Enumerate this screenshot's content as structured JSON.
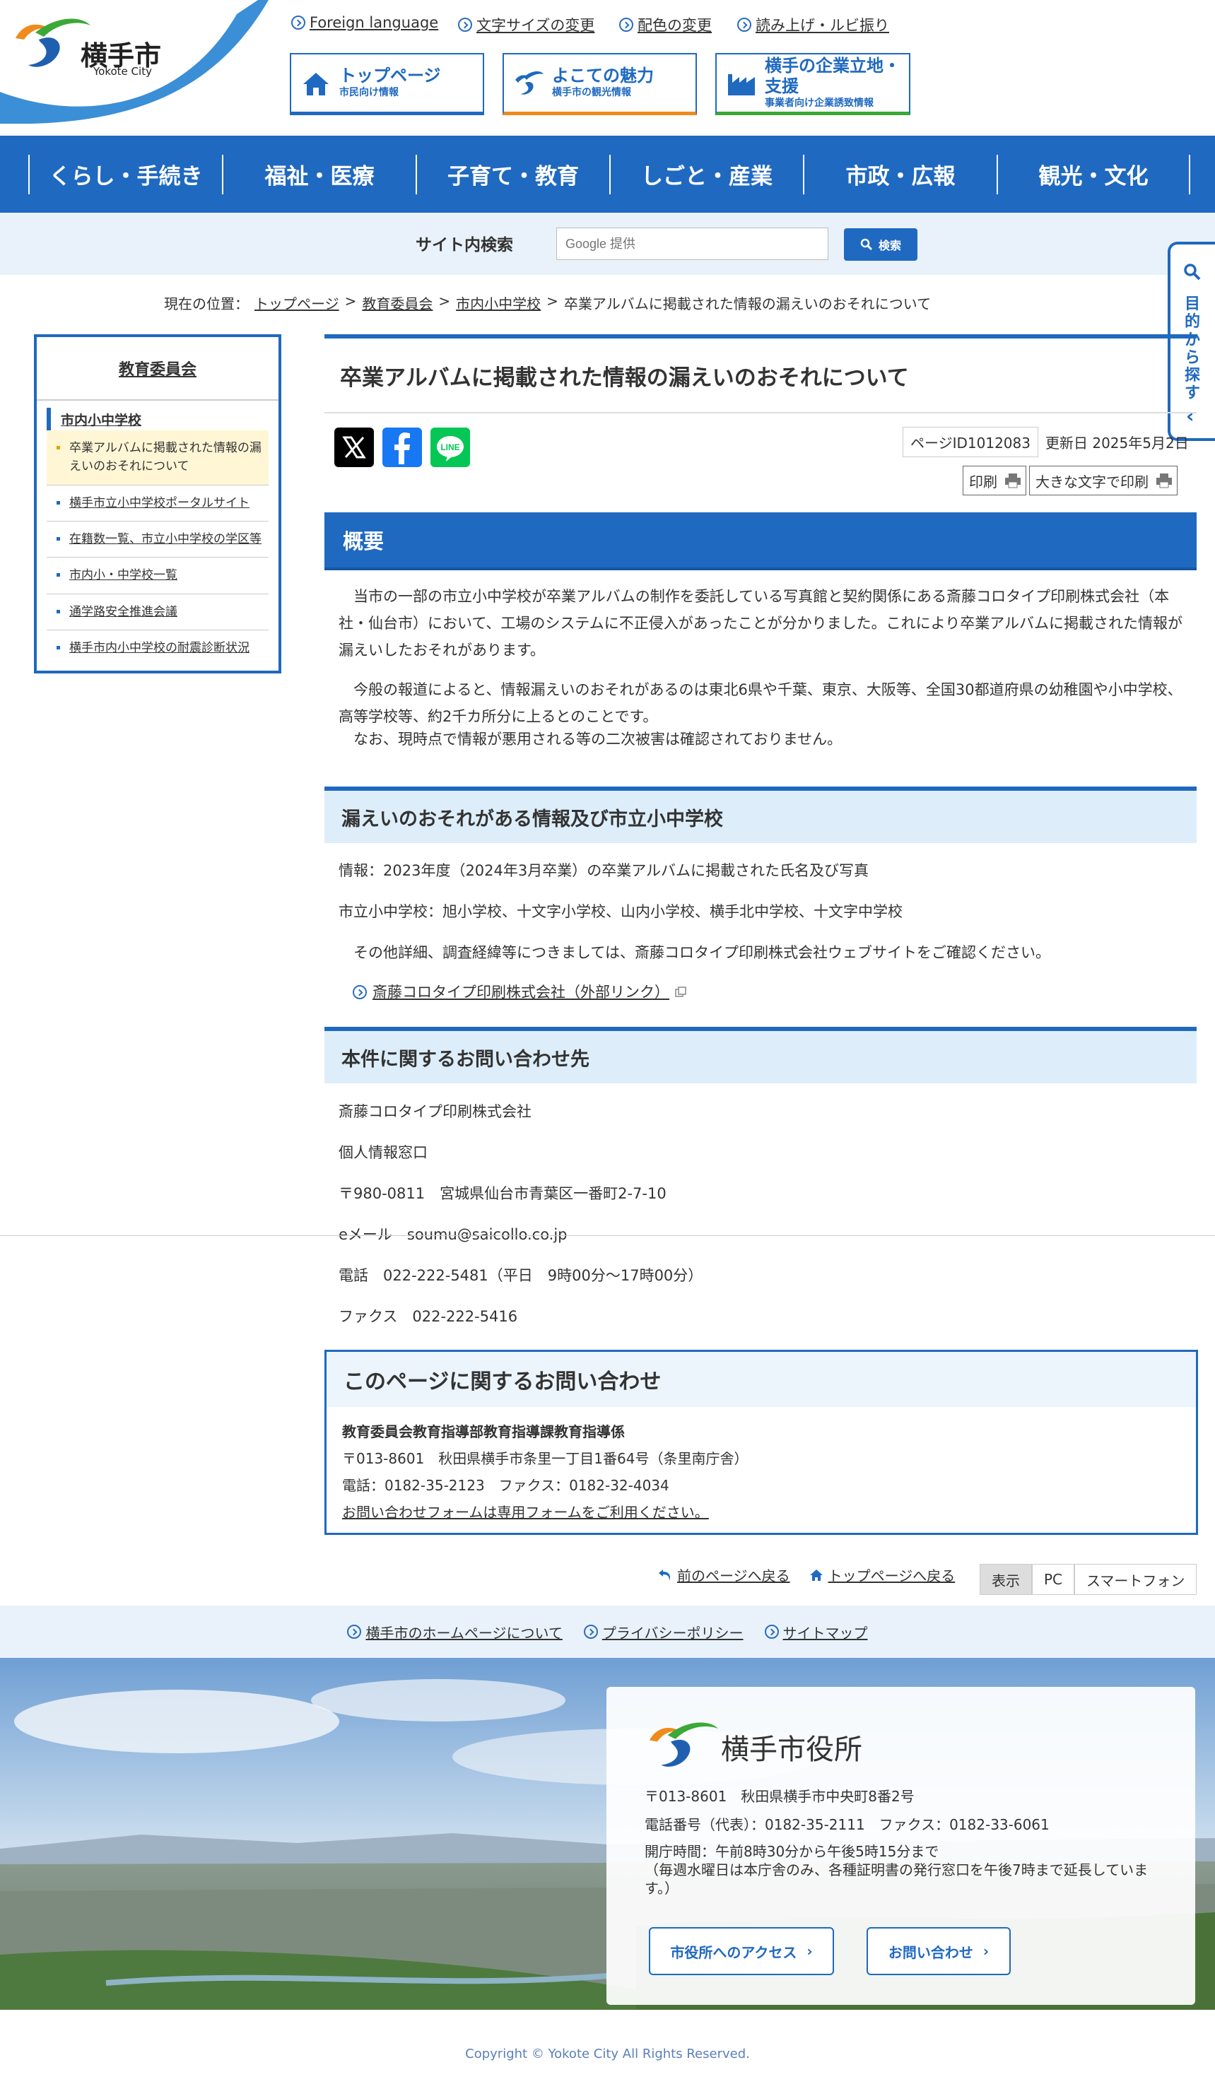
{
  "header": {
    "logo_text": "横手市",
    "logo_sub": "Yokote City",
    "util_links": [
      "Foreign language",
      "文字サイズの変更",
      "配色の変更",
      "読み上げ・ルビ振り"
    ],
    "buttons": [
      {
        "title": "トップページ",
        "sub": "市民向け情報"
      },
      {
        "title": "よこての魅力",
        "sub": "横手市の観光情報"
      },
      {
        "title": "横手の企業立地・支援",
        "sub": "事業者向け企業誘致情報"
      }
    ]
  },
  "gnav": [
    "くらし・手続き",
    "福祉・医療",
    "子育て・教育",
    "しごと・産業",
    "市政・広報",
    "観光・文化"
  ],
  "search": {
    "label": "サイト内検索",
    "placeholder": "Google 提供",
    "button": "検索"
  },
  "side_tab": {
    "label": "目的から探す",
    "chevron": "‹"
  },
  "breadcrumb": {
    "prefix": "現在の位置：",
    "items": [
      "トップページ",
      "教育委員会",
      "市内小中学校"
    ],
    "current": "卒業アルバムに掲載された情報の漏えいのおそれについて",
    "sep": ">"
  },
  "sidebar": {
    "title": "教育委員会",
    "category": "市内小中学校",
    "items": [
      "卒業アルバムに掲載された情報の漏えいのおそれについて",
      "横手市立小中学校ポータルサイト",
      "在籍数一覧、市立小中学校の学区等",
      "市内小・中学校一覧",
      "通学路安全推進会議",
      "横手市内小中学校の耐震診断状況"
    ]
  },
  "page": {
    "title": "卒業アルバムに掲載された情報の漏えいのおそれについて",
    "page_id": "ページID1012083",
    "updated": "更新日 2025年5月2日",
    "print": "印刷",
    "print_large": "大きな文字で印刷",
    "sns": [
      "X",
      "Facebook",
      "LINE"
    ]
  },
  "overview": {
    "heading": "概要",
    "p1": "当市の一部の市立小中学校が卒業アルバムの制作を委託している写真館と契約関係にある斎藤コロタイプ印刷株式会社（本社・仙台市）において、工場のシステムに不正侵入があったことが分かりました。これにより卒業アルバムに掲載された情報が漏えいしたおそれがあります。",
    "p2": "今般の報道によると、情報漏えいのおそれがあるのは東北6県や千葉、東京、大阪等、全国30都道府県の幼稚園や小中学校、高等学校等、約2千カ所分に上るとのことです。",
    "p3": "なお、現時点で情報が悪用される等の二次被害は確認されておりません。"
  },
  "leak": {
    "heading": "漏えいのおそれがある情報及び市立小中学校",
    "info": "情報：2023年度（2024年3月卒業）の卒業アルバムに掲載された氏名及び写真",
    "schools": "市立小中学校：旭小学校、十文字小学校、山内小学校、横手北中学校、十文字中学校",
    "note": "その他詳細、調査経緯等につきましては、斎藤コロタイプ印刷株式会社ウェブサイトをご確認ください。",
    "link": "斎藤コロタイプ印刷株式会社（外部リンク）"
  },
  "inquiry": {
    "heading": "本件に関するお問い合わせ先",
    "lines": [
      "斎藤コロタイプ印刷株式会社",
      "個人情報窓口",
      "〒980-0811　宮城県仙台市青葉区一番町2-7-10",
      "eメール　soumu@saicollo.co.jp",
      "電話　022-222-5481（平日　9時00分～17時00分）",
      "ファクス　022-222-5416"
    ]
  },
  "contact_box": {
    "heading": "このページに関するお問い合わせ",
    "dept": "教育委員会教育指導部教育指導課教育指導係",
    "address": "〒013-8601　秋田県横手市条里一丁目1番64号（条里南庁舎）",
    "phone": "電話：0182-35-2123　ファクス：0182-32-4034",
    "form": "お問い合わせフォームは専用フォームをご利用ください。"
  },
  "bottom": {
    "back": "前のページへ戻る",
    "top": "トップページへ戻る",
    "view_label": "表示",
    "view_pc": "PC",
    "view_sp": "スマートフォン"
  },
  "footer_links": [
    "横手市のホームページについて",
    "プライバシーポリシー",
    "サイトマップ"
  ],
  "footer": {
    "name": "横手市役所",
    "address": "〒013-8601　秋田県横手市中央町8番2号",
    "phone": "電話番号（代表）：0182-35-2111　ファクス：0182-33-6061",
    "hours": "開庁時間：午前8時30分から午後5時15分まで",
    "hours_note": "（毎週水曜日は本庁舎のみ、各種証明書の発行窓口を午後7時まで延長しています。）",
    "btn_access": "市役所へのアクセス",
    "btn_contact": "お問い合わせ",
    "copyright": "Copyright © Yokote City All Rights Reserved."
  },
  "colors": {
    "primary": "#1f69c0",
    "light": "#ddeefa",
    "accent_orange": "#f08a1c",
    "accent_green": "#3aa935"
  }
}
